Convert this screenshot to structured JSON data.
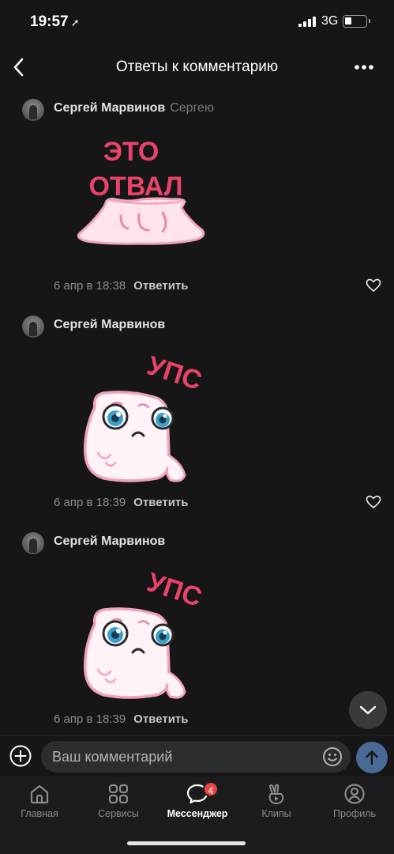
{
  "status_bar": {
    "time": "19:57",
    "network": "3G"
  },
  "header": {
    "title": "Ответы к комментарию"
  },
  "comments": [
    {
      "author": "Сергей Марвинов",
      "reply_to": "Сергею",
      "sticker_text": [
        "ЭТО",
        "ОТВАЛ"
      ],
      "date": "6 апр в 18:38",
      "reply_label": "Ответить"
    },
    {
      "author": "Сергей Марвинов",
      "reply_to": "",
      "sticker_text": [
        "УПС"
      ],
      "date": "6 апр в 18:39",
      "reply_label": "Ответить"
    },
    {
      "author": "Сергей Марвинов",
      "reply_to": "",
      "sticker_text": [
        "УПС"
      ],
      "date": "6 апр в 18:39",
      "reply_label": "Ответить"
    }
  ],
  "composer": {
    "placeholder": "Ваш комментарий"
  },
  "tabbar": {
    "tabs": [
      {
        "label": "Главная",
        "icon": "home-icon"
      },
      {
        "label": "Сервисы",
        "icon": "services-icon"
      },
      {
        "label": "Мессенджер",
        "icon": "messenger-icon",
        "badge": "4",
        "active": true
      },
      {
        "label": "Клипы",
        "icon": "clips-icon"
      },
      {
        "label": "Профиль",
        "icon": "profile-icon"
      }
    ]
  },
  "colors": {
    "background": "#161616",
    "sticker_text": "#e8436a",
    "accent": "#4a6a96",
    "badge": "#e64646"
  }
}
